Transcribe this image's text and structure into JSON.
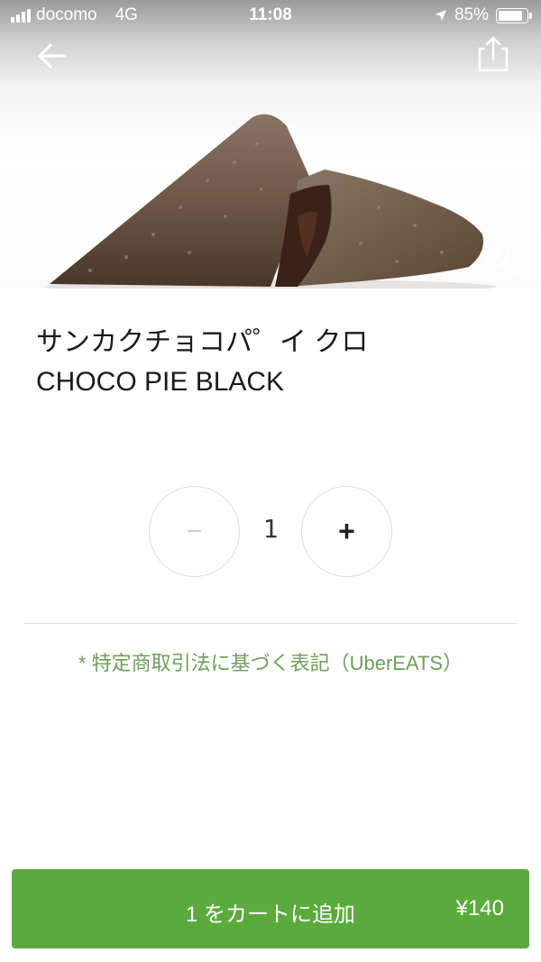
{
  "status_bar": {
    "carrier": "docomo",
    "network": "4G",
    "time": "11:08",
    "battery_percent": "85%",
    "battery_level": 0.85,
    "icons": [
      "signal-icon",
      "location-arrow-icon",
      "battery-icon"
    ]
  },
  "header": {
    "back_icon": "back-arrow-icon",
    "share_icon": "share-icon",
    "zoom_icon": "zoom-in-icon"
  },
  "product": {
    "name_ja": "サンカクチョコパ゜イ クロ",
    "name_en": "CHOCO PIE BLACK"
  },
  "quantity": {
    "value": "1",
    "minus_label": "−",
    "plus_label": "+"
  },
  "legal_link": "* 特定商取引法に基づく表記（UberEATS）",
  "cta": {
    "label": "1 をカートに追加",
    "price": "¥140"
  },
  "colors": {
    "accent_green": "#5bab3c",
    "link_green": "#6e9e5a"
  }
}
